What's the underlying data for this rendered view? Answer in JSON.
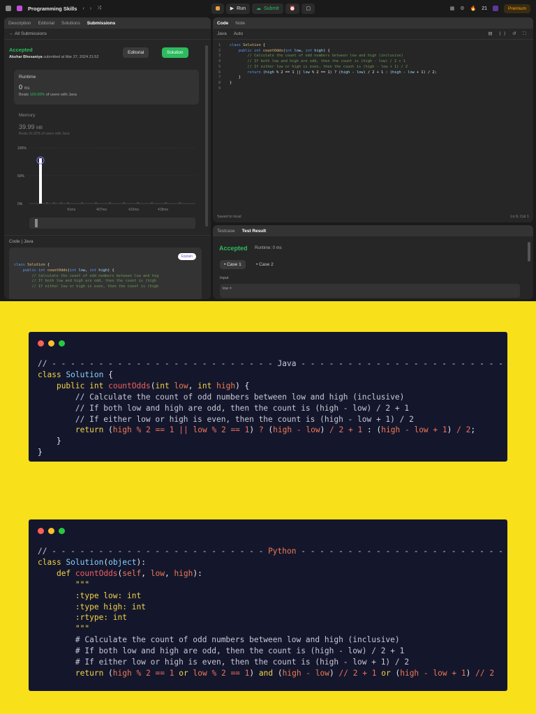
{
  "app": {
    "title": "Programming Skills",
    "run": "Run",
    "submit": "Submit",
    "streak": "21",
    "premium": "Premium"
  },
  "left": {
    "tabs": [
      "Description",
      "Editorial",
      "Solutions",
      "Submissions"
    ],
    "back": "All Submissions",
    "status": "Accepted",
    "author": "Akshar Bhesaniya",
    "submitted": "submitted at Mar 27, 2024 21:52",
    "editorial_btn": "Editorial",
    "solution_btn": "Solution",
    "runtime_label": "Runtime",
    "runtime_val": "0",
    "runtime_unit": "ms",
    "beats_rt": "Beats",
    "beats_rt_pct": "100.00%",
    "beats_rt_tail": "of users with Java",
    "memory_label": "Memory",
    "memory_val": "39.99",
    "memory_unit": "MB",
    "beats_mem": "Beats",
    "beats_mem_pct": "91.02%",
    "beats_mem_tail": "of users with Java",
    "y_ticks": [
      "100%",
      "50%",
      "0%"
    ],
    "x_ticks": [
      "41ms",
      "407ms",
      "410ms",
      "418ms"
    ],
    "code_label": "Code",
    "code_lang": "Java",
    "explain": "Explain"
  },
  "editor": {
    "tab_code": "Code",
    "tab_note": "Note",
    "lang": "Java",
    "auto": "Auto",
    "saved": "Saved to local",
    "pos": "Ln 9, Col 1"
  },
  "result": {
    "tab1": "Testcase",
    "tab2": "Test Result",
    "status": "Accepted",
    "runtime": "Runtime: 0 ms",
    "case1": "Case 1",
    "case2": "Case 2",
    "input": "Input",
    "low": "low ="
  },
  "java": {
    "header": "Java"
  },
  "python": {
    "header": "Python"
  },
  "colors": {
    "accent": "#2cbb5d",
    "yellow": "#f8e01b",
    "card": "#14172b"
  }
}
